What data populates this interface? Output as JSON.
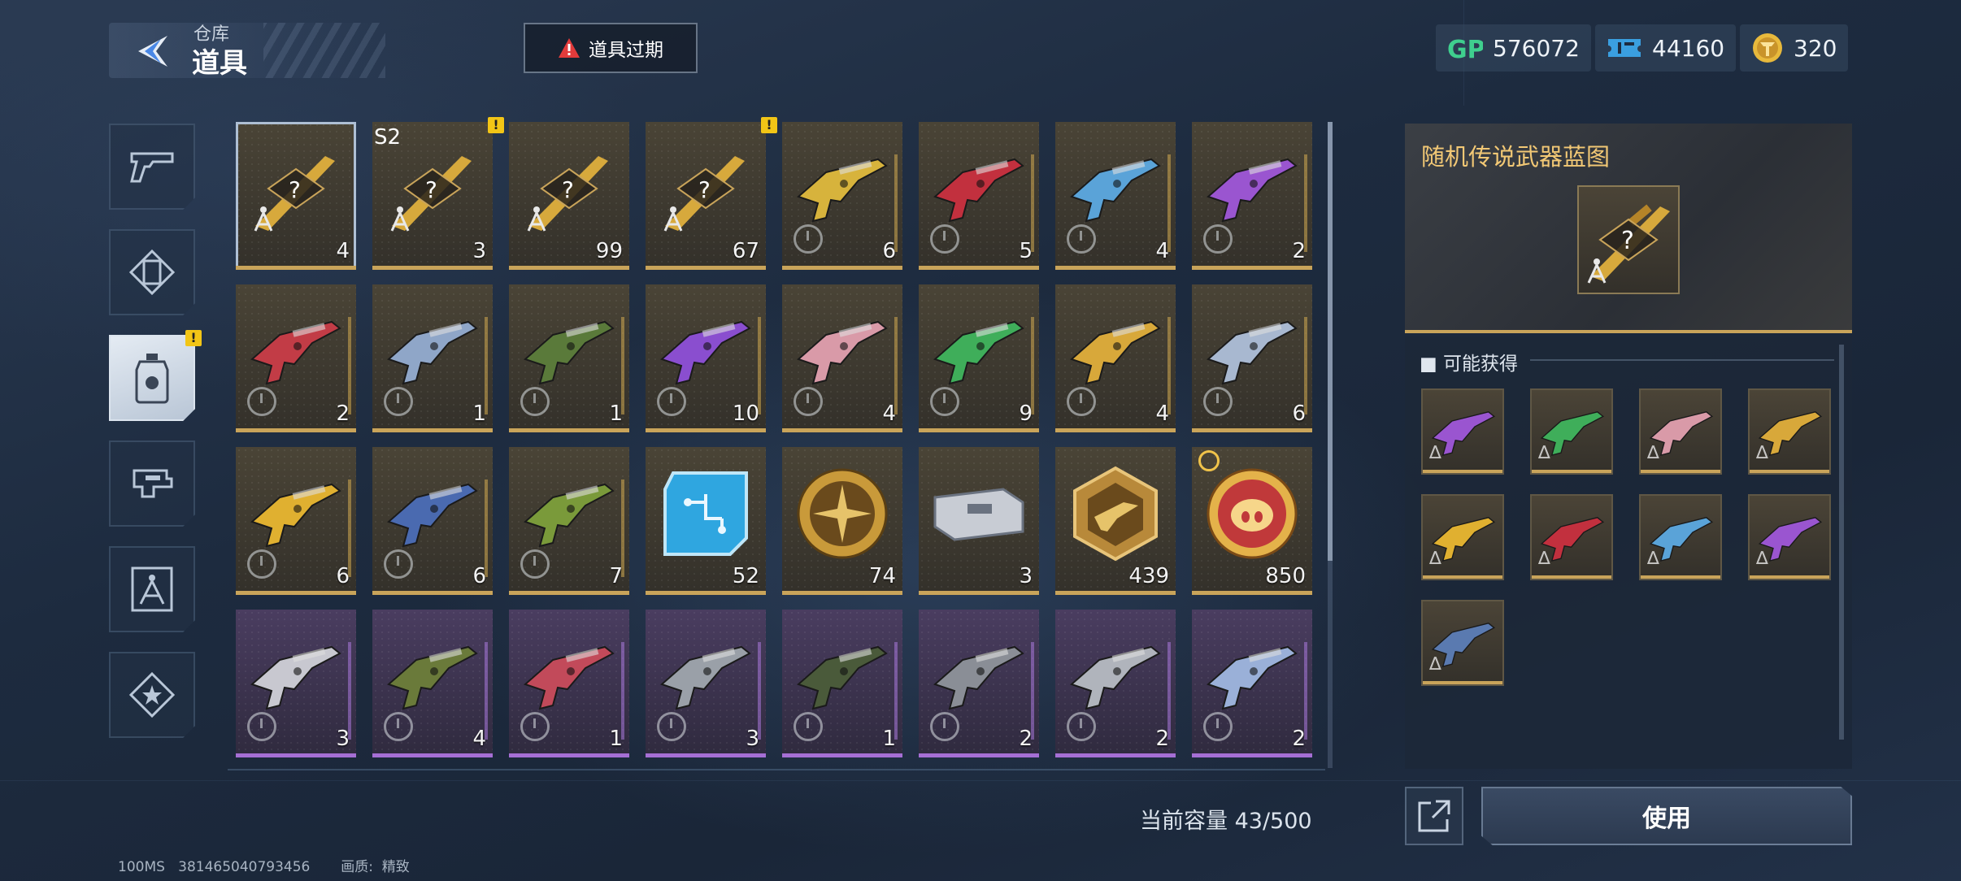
{
  "header": {
    "breadcrumb_parent": "仓库",
    "title": "道具",
    "expire_button_label": "道具过期",
    "currencies": [
      {
        "icon": "gp-icon",
        "value": "576072",
        "color": "#3fcf8e"
      },
      {
        "icon": "ticket-icon",
        "value": "44160",
        "color": "#3a9fe0"
      },
      {
        "icon": "token-coin-icon",
        "value": "320",
        "color": "#e8b93c"
      }
    ]
  },
  "sidebar": {
    "tabs": [
      {
        "name": "weapons",
        "icon": "pistol-icon"
      },
      {
        "name": "skins",
        "icon": "card-frame-icon"
      },
      {
        "name": "items",
        "icon": "bottle-icon",
        "active": true,
        "alert": true
      },
      {
        "name": "attachments",
        "icon": "gun-part-icon"
      },
      {
        "name": "blueprints",
        "icon": "compass-icon"
      },
      {
        "name": "badges",
        "icon": "star-badge-icon"
      }
    ]
  },
  "grid": {
    "rows": [
      [
        {
          "type": "blueprint",
          "qty": "4",
          "rarity": "gold",
          "selected": true
        },
        {
          "type": "blueprint",
          "qty": "3",
          "rarity": "gold",
          "season": "S2",
          "alert": true
        },
        {
          "type": "blueprint",
          "qty": "99",
          "rarity": "gold"
        },
        {
          "type": "blueprint",
          "qty": "67",
          "rarity": "gold",
          "alert": true
        },
        {
          "type": "weapon",
          "qty": "6",
          "rarity": "gold",
          "color": "#d7b33c"
        },
        {
          "type": "weapon",
          "qty": "5",
          "rarity": "gold",
          "color": "#c2303e"
        },
        {
          "type": "weapon",
          "qty": "4",
          "rarity": "gold",
          "color": "#5aa3d8"
        },
        {
          "type": "weapon",
          "qty": "2",
          "rarity": "gold",
          "color": "#9a55d0"
        }
      ],
      [
        {
          "type": "weapon",
          "qty": "2",
          "rarity": "gold",
          "color": "#c23c46"
        },
        {
          "type": "weapon",
          "qty": "1",
          "rarity": "gold",
          "color": "#8fa6c8"
        },
        {
          "type": "weapon",
          "qty": "1",
          "rarity": "gold",
          "color": "#5a7a3a"
        },
        {
          "type": "weapon",
          "qty": "10",
          "rarity": "gold",
          "color": "#8a4ecf"
        },
        {
          "type": "weapon",
          "qty": "4",
          "rarity": "gold",
          "color": "#d99aa8"
        },
        {
          "type": "weapon",
          "qty": "9",
          "rarity": "gold",
          "color": "#3fae5a"
        },
        {
          "type": "weapon",
          "qty": "4",
          "rarity": "gold",
          "color": "#d8a83a"
        },
        {
          "type": "weapon",
          "qty": "6",
          "rarity": "gold",
          "color": "#a8b8d0"
        }
      ],
      [
        {
          "type": "weapon",
          "qty": "6",
          "rarity": "gold",
          "color": "#e0b030"
        },
        {
          "type": "weapon",
          "qty": "6",
          "rarity": "gold",
          "color": "#4a6ab0"
        },
        {
          "type": "weapon",
          "qty": "7",
          "rarity": "gold",
          "color": "#7a9a3a"
        },
        {
          "type": "chip",
          "qty": "52",
          "rarity": "gold",
          "color": "#2fa6e0"
        },
        {
          "type": "medal",
          "qty": "74",
          "rarity": "gold",
          "color": "#c99a3a"
        },
        {
          "type": "case",
          "qty": "3",
          "rarity": "gold",
          "color": "#c8ccd4"
        },
        {
          "type": "hexbadge",
          "qty": "439",
          "rarity": "gold",
          "color": "#b8893a"
        },
        {
          "type": "piggy",
          "qty": "850",
          "rarity": "gold",
          "color": "#c0393a",
          "timer": true
        }
      ],
      [
        {
          "type": "weapon",
          "qty": "3",
          "rarity": "purple",
          "color": "#c8c8d0"
        },
        {
          "type": "weapon",
          "qty": "4",
          "rarity": "purple",
          "color": "#6a7a3a"
        },
        {
          "type": "weapon",
          "qty": "1",
          "rarity": "purple",
          "color": "#c24a5a"
        },
        {
          "type": "weapon",
          "qty": "3",
          "rarity": "purple",
          "color": "#9aa0a8"
        },
        {
          "type": "weapon",
          "qty": "1",
          "rarity": "purple",
          "color": "#4a5a3a"
        },
        {
          "type": "weapon",
          "qty": "2",
          "rarity": "purple",
          "color": "#8a8e96"
        },
        {
          "type": "weapon",
          "qty": "2",
          "rarity": "purple",
          "color": "#b0b4bc"
        },
        {
          "type": "weapon",
          "qty": "2",
          "rarity": "purple",
          "color": "#9ab0d8"
        }
      ]
    ]
  },
  "capacity_text": "当前容量 43/500",
  "footer": {
    "ping": "100MS",
    "uid": "381465040793456",
    "quality_label": "画质:",
    "quality_value": "精致"
  },
  "detail": {
    "title": "随机传说武器蓝图",
    "section_label": "可能获得",
    "possible_items": [
      {
        "color": "#9a55d0"
      },
      {
        "color": "#3fae5a"
      },
      {
        "color": "#d99aa8"
      },
      {
        "color": "#d8a83a"
      },
      {
        "color": "#e0b030"
      },
      {
        "color": "#c2303e"
      },
      {
        "color": "#5aa3d8"
      },
      {
        "color": "#9a55d0"
      },
      {
        "color": "#5a7ab0"
      }
    ],
    "use_button_label": "使用"
  }
}
